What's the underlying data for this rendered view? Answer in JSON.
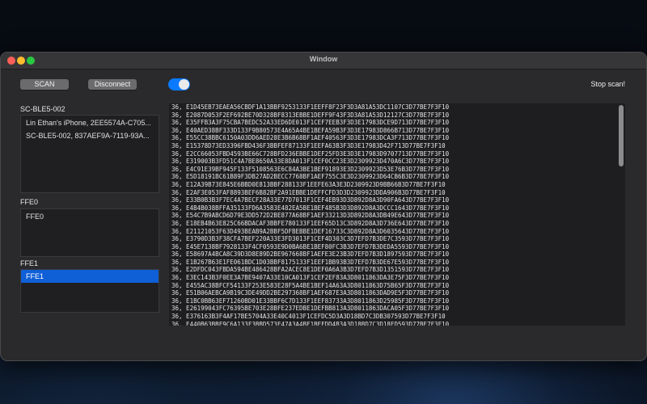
{
  "window": {
    "title": "Window"
  },
  "toolbar": {
    "scan_label": "SCAN",
    "disconnect_label": "Disconnect",
    "toggle_on": true,
    "stop_label": "Stop scan!"
  },
  "devices": {
    "label": "SC-BLE5-002",
    "items": [
      "Lin Ethan's iPhone, 2EE5574A-C705...",
      "SC-BLE5-002, 837AEF9A-7119-93A..."
    ]
  },
  "services": {
    "label": "FFE0",
    "items": [
      "FFE0"
    ]
  },
  "characteristics": {
    "label": "FFE1",
    "items": [
      "FFE1"
    ],
    "selected_index": 0
  },
  "log": {
    "lines": [
      "36, E1D45EB73EAEA56CBDF1A13BBF9253133F1EEFF8F23F3D3A81A53DC1107C3D77BE7F3F10",
      "36, E2087D053F2EF692BE70D328BF8313EBBE1DEFF9F43F3D3A81A53D12127C3D77BE7F3F10",
      "36, E35FFB3A3F75CBA7BEDC52A33ED6DE013F1CEF7EEB3F3D3E17983DCE9D713D77BE7F3F10",
      "36, E40AED38BF333D133F9B80573E4A65A4BE1BEFA59B3F3D3E17983D866B713D77BE7F3F10",
      "36, E55CC38BBC6150A03DD6AED28E3B6B68BF1AEF40563F3D3E17983DCA3F713D77BE7F3F10",
      "36, E15378D73ED3396FBD436F3BBFEF87133F1EEFA63B3F3D3E17983D42F713D77BE7F3F10",
      "36, E2CC66053FBD4593BE66C728BFD236EBBE1DEF25FD3E3D3E17983D9707713D77BE7F3F10",
      "36, E319003B3FD51C4A7BE8650A33E8DA013F1CEF0CC23E3D2309923D470A6C3D77BE7F3F10",
      "36, E4C91E39BF945F133F5108563E6C84A3BE1BEF91893E3D2309923D53E76B3D77BE7F3F10",
      "36, E5D18191BC61B89F3DB27AD2BECC7768BF1AEF755C3E3D2309923D64CB6B3D77BE7F3F10",
      "36, E12A39B73E845E6BBD0E813BBF288133F1EEFE63A3E3D2309923D9BB66B3D77BE7F3F10",
      "36, E2AF3E053FAF8893BEF6B82BF2A91EBBE1DEFFCFD3D3D2309923DDA906B3D77BE7F3F10",
      "36, E33B0B3B3F7EC4A7BECF28A33E77D7013F1CEF4EB93D3D892D8A3D90FA643D77BE7F3F10",
      "36, E4B4B038BFFA35133FD6A3583E482EA5BE1BEF485B3D3D892D8A3DCCC1643D77BE7F3F10",
      "36, E54C7B9ABCD6D79E3DD572D2BE877A68BF1AEF33213D3D892D8A3DB49E643D77BE7F3F10",
      "36, E18EB4B63E825C66BDACAF3BBFE780133F1EEF65D13C3D892D8A3D736E643D77BE7F3F10",
      "36, E21121053F63D493BEAB9A2BBF5DFBEBBE1DEF16733C3D892D8A3D6035643D77BE7F3F10",
      "36, E3790D3B3F38CFA7BEF220A33E3FD3013F1CEF4D303C3D7EFD7B3DE7C3593D77BE7F3F10",
      "36, E45E7138BF7928133F4CF0593E9D0BA6BE1BEF80FC3B3D7EFD7B3DEDA5593D77BE7F3F10",
      "36, E58697A4BCA8C39D3D8E89D2BE967668BF1AEFE3E23B3D7EFD7B3D1897593D77BE7F3F10",
      "36, E1B267B63E1FE061BDC1D03BBF8175133F1EEF1BB93B3D7EFD7B3DE67E593D77BE7F3F10",
      "36, E2DFDC043FBDA594BE486428BFA2ACEC8E1DEF0A6A3B3D7EFD7B3D1351593D77BE7F3F10",
      "36, E3EC143B3F0EE3A7BE9407A33E10CA013F1CEF2EF83A3D8011863DA3E75F3D77BE7F3F10",
      "36, E455AC38BFCF54133F253E583E28F5A4BE1BEF14A63A3D8011863D75B65F3D77BE7F3F10",
      "36, E51B06AEBCA9B19C3DE49DD2BE297368BF1AEF687E3A3D8011863DAD9E5F3D77BE7F3F10",
      "36, E1BC0BB63EF71260BD01E33BBF6C7D133F1EEF83733A3D8011863D25985F3D77BE7F3F10",
      "36, E26199043FC76395BE703E28BFE237EDBE1DEFBB813A3D8011863DACA05F3D77BE7F3F10",
      "36, E376163B3F4AF17BE5704A33E40C4013F1CEFDC5D3A3D18BD7C3DB307593D77BE7F3F10",
      "36, E440B63BBF9C6A133F3BBD573E47A3A4BE1BEFDD4B3A3D18BD7C3D18FD593D77BE7F3F10"
    ]
  },
  "scrollbar": {
    "position": 0.0,
    "visible_fraction": 0.28
  },
  "colors": {
    "accent": "#0a7aff",
    "selection": "#0f5fd6",
    "window_bg": "#2a2a2c",
    "log_bg": "#1e1e20"
  },
  "icons": [
    "close-icon",
    "minimize-icon",
    "zoom-icon"
  ]
}
